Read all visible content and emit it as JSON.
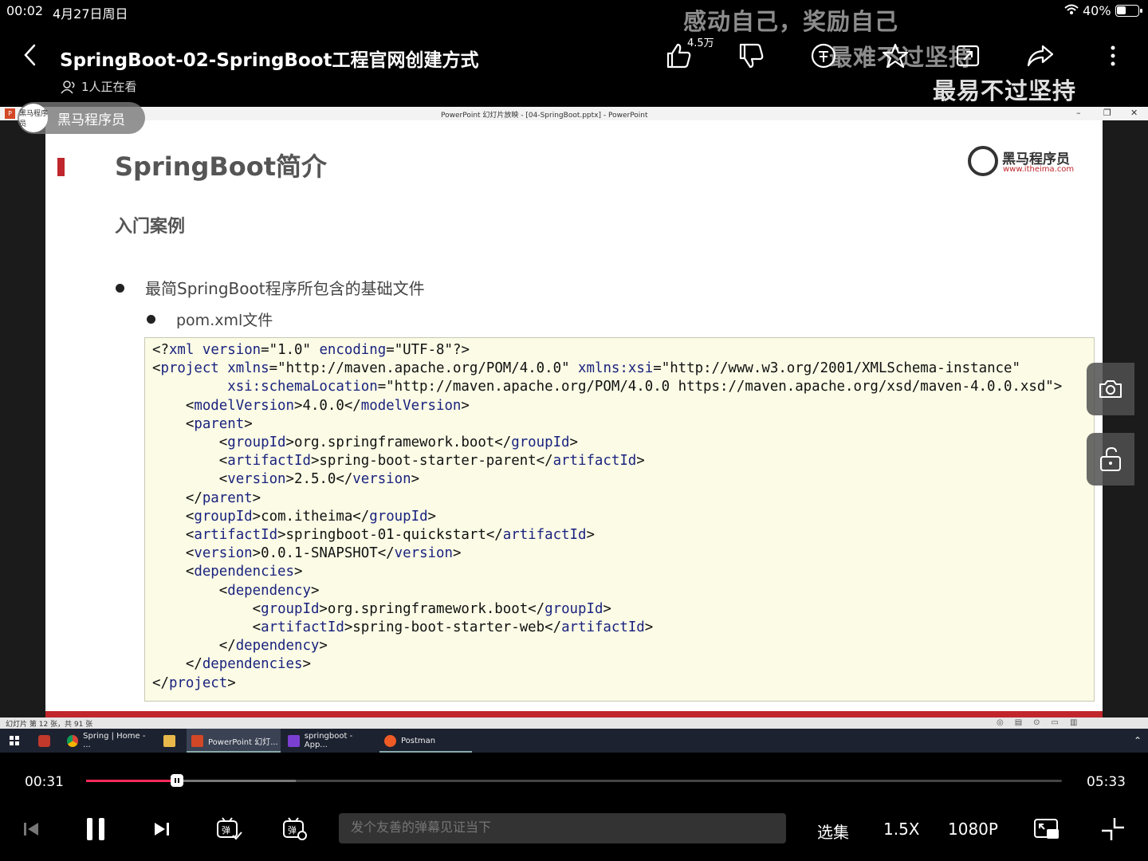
{
  "status_bar": {
    "time": "00:02",
    "date": "4月27日周日",
    "battery": "40%",
    "battery_level": 0.4
  },
  "header": {
    "title": "SpringBoot-02-SpringBoot工程官网创建方式",
    "viewers": "1人正在看",
    "like_count": "4.5万"
  },
  "danmaku": [
    "感动自己，奖励自己",
    "最难不过坚持",
    "最易不过坚持"
  ],
  "channel_badge": {
    "name": "黑马程序员",
    "avatar_label": "黑马程序员"
  },
  "powerpoint": {
    "window_title": "PowerPoint 幻灯片放映 - [04-SpringBoot.pptx] - PowerPoint",
    "status": "幻灯片 第 12 张，共 91 张",
    "slide": {
      "title": "SpringBoot简介",
      "subtitle": "入门案例",
      "bullet1": "最简SpringBoot程序所包含的基础文件",
      "bullet2": "pom.xml文件",
      "logo_name": "黑马程序员",
      "logo_url": "www.itheima.com"
    }
  },
  "taskbar": {
    "items": [
      {
        "label": "Spring | Home - ..."
      },
      {
        "label": "PowerPoint 幻灯..."
      },
      {
        "label": "springboot - App..."
      },
      {
        "label": "Postman"
      }
    ]
  },
  "player": {
    "current_time": "00:31",
    "total_time": "05:33",
    "progress": 0.093,
    "buffered": 0.215,
    "danmaku_placeholder": "发个友善的弹幕见证当下",
    "episodes_label": "选集",
    "speed_label": "1.5X",
    "quality_label": "1080P"
  },
  "colors": {
    "accent_red": "#c0262c",
    "progress_pink": "#ff2a5a",
    "code_bg": "#fbfbe6",
    "code_tag": "#1a237e"
  }
}
